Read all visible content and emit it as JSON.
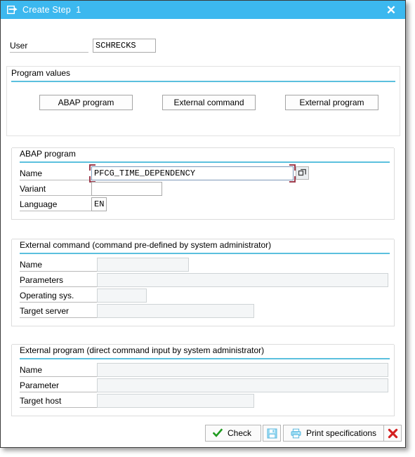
{
  "window": {
    "title": "Create Step  1",
    "title_icon": "step-create-icon",
    "close_icon": "close-icon",
    "accent_color": "#3cb8ef",
    "rule_color": "#5bc0de"
  },
  "user_row": {
    "label": "User",
    "value": "SCHRECKS"
  },
  "program_values": {
    "title": "Program values",
    "buttons": [
      {
        "label": "ABAP program"
      },
      {
        "label": "External command"
      },
      {
        "label": "External program"
      }
    ]
  },
  "abap_program": {
    "title": "ABAP program",
    "fields": [
      {
        "label": "Name",
        "value": "PFCG_TIME_DEPENDENCY",
        "focused": true,
        "disabled": false
      },
      {
        "label": "Variant",
        "value": "",
        "focused": false,
        "disabled": false
      },
      {
        "label": "Language",
        "value": "EN",
        "focused": false,
        "disabled": false
      }
    ],
    "search_help_icon": "search-help-icon"
  },
  "external_command": {
    "title": "External command (command pre-defined by system administrator)",
    "fields": [
      {
        "label": "Name",
        "value": "",
        "disabled": true
      },
      {
        "label": "Parameters",
        "value": "",
        "disabled": true
      },
      {
        "label": "Operating sys.",
        "value": "",
        "disabled": true
      },
      {
        "label": "Target server",
        "value": "",
        "disabled": true
      }
    ]
  },
  "external_program": {
    "title": "External program (direct command input by system administrator)",
    "fields": [
      {
        "label": "Name",
        "value": "",
        "disabled": true
      },
      {
        "label": "Parameter",
        "value": "",
        "disabled": true
      },
      {
        "label": "Target host",
        "value": "",
        "disabled": true
      }
    ]
  },
  "toolbar": {
    "check_label": "Check",
    "check_icon": "green-check-icon",
    "save_icon": "save-floppy-icon",
    "print_icon": "printer-icon",
    "print_label": "Print specifications",
    "cancel_icon": "red-x-icon"
  }
}
